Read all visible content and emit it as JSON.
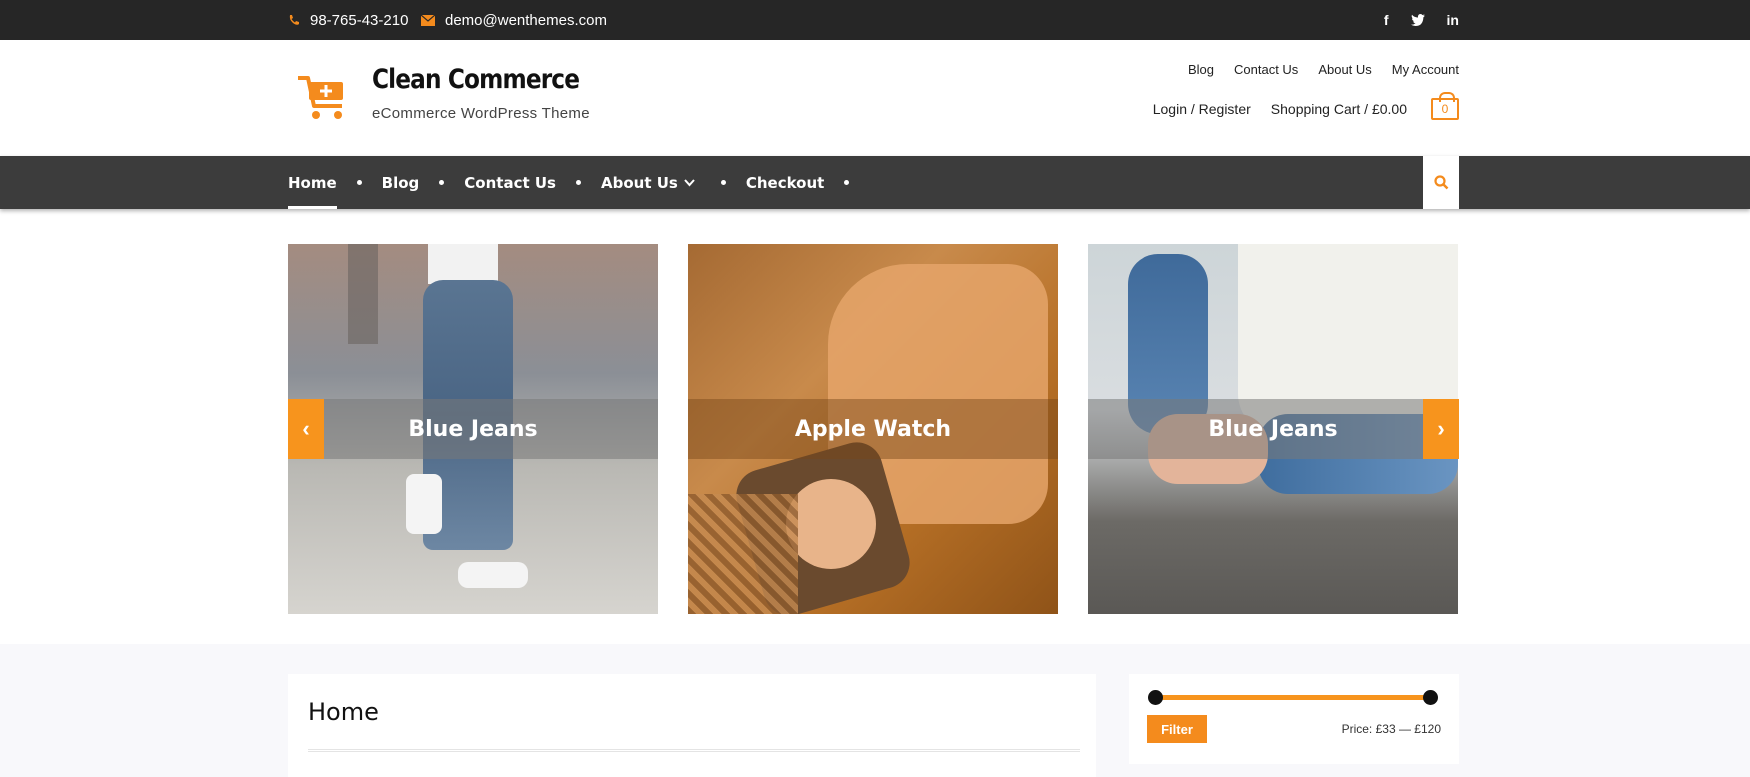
{
  "topbar": {
    "phone": "98-765-43-210",
    "email": "demo@wenthemes.com",
    "social": [
      "f",
      "twitter-icon",
      "in"
    ]
  },
  "brand": {
    "title": "Clean Commerce",
    "tagline": "eCommerce WordPress Theme",
    "accent": "#f48b1d"
  },
  "secondary_nav": [
    "Blog",
    "Contact Us",
    "About Us",
    "My Account"
  ],
  "account": {
    "login": "Login / Register",
    "cart": "Shopping Cart / £0.00",
    "cart_count": "0"
  },
  "main_nav": {
    "items": [
      "Home",
      "Blog",
      "Contact Us",
      "About Us",
      "Checkout"
    ],
    "active": "Home"
  },
  "slider": {
    "slides": [
      "Blue Jeans",
      "Apple Watch",
      "Blue Jeans"
    ],
    "prev": "‹",
    "next": "›"
  },
  "content": {
    "title": "Home"
  },
  "price_filter": {
    "button": "Filter",
    "label": "Price: £33 — £120",
    "min": 33,
    "max": 120
  }
}
